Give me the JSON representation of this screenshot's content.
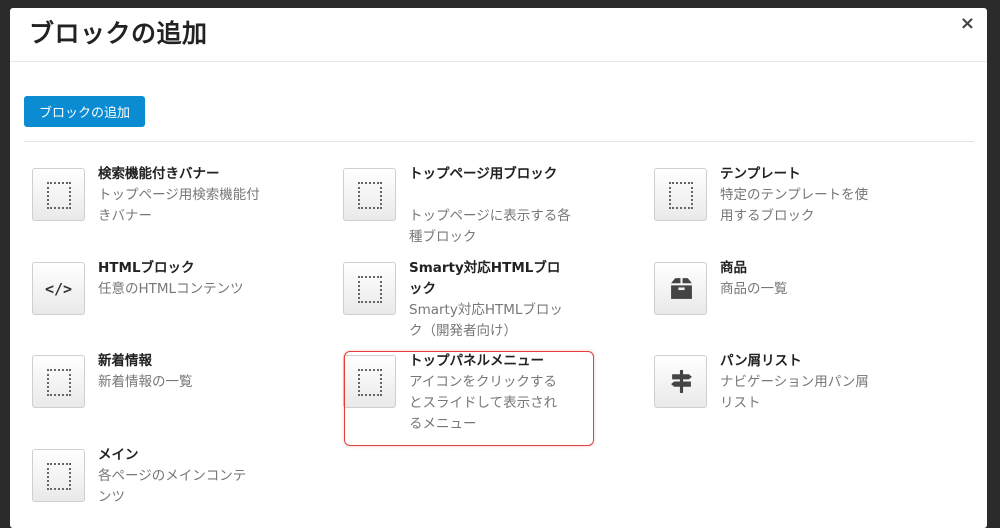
{
  "modal": {
    "title": "ブロックの追加",
    "close_symbol": "×",
    "add_button_label": "ブロックの追加"
  },
  "blocks": [
    {
      "name": "検索機能付きバナー",
      "desc": "トップページ用検索機能付きバナー",
      "icon": "dotted-square-icon"
    },
    {
      "name": "トップページ用ブロック",
      "desc": "トップページに表示する各種ブロック",
      "icon": "dotted-square-icon"
    },
    {
      "name": "テンプレート",
      "desc": "特定のテンプレートを使用するブロック",
      "icon": "dotted-square-icon"
    },
    {
      "name": "HTMLブロック",
      "desc": "任意のHTMLコンテンツ",
      "icon": "code-icon",
      "icon_text": "</>"
    },
    {
      "name": "Smarty対応HTMLブロック",
      "desc": "Smarty対応HTMLブロック（開発者向け）",
      "icon": "dotted-square-icon"
    },
    {
      "name": "商品",
      "desc": "商品の一覧",
      "icon": "package-icon"
    },
    {
      "name": "新着情報",
      "desc": "新着情報の一覧",
      "icon": "dotted-square-icon"
    },
    {
      "name": "トップパネルメニュー",
      "desc": "アイコンをクリックするとスライドして表示されるメニュー",
      "icon": "dotted-square-icon"
    },
    {
      "name": "パン屑リスト",
      "desc": "ナビゲーション用パン屑リスト",
      "icon": "signpost-icon"
    },
    {
      "name": "メイン",
      "desc": "各ページのメインコンテンツ",
      "icon": "dotted-square-icon"
    }
  ],
  "highlight_color": "#e0403b",
  "accent_color": "#0b8bd1"
}
